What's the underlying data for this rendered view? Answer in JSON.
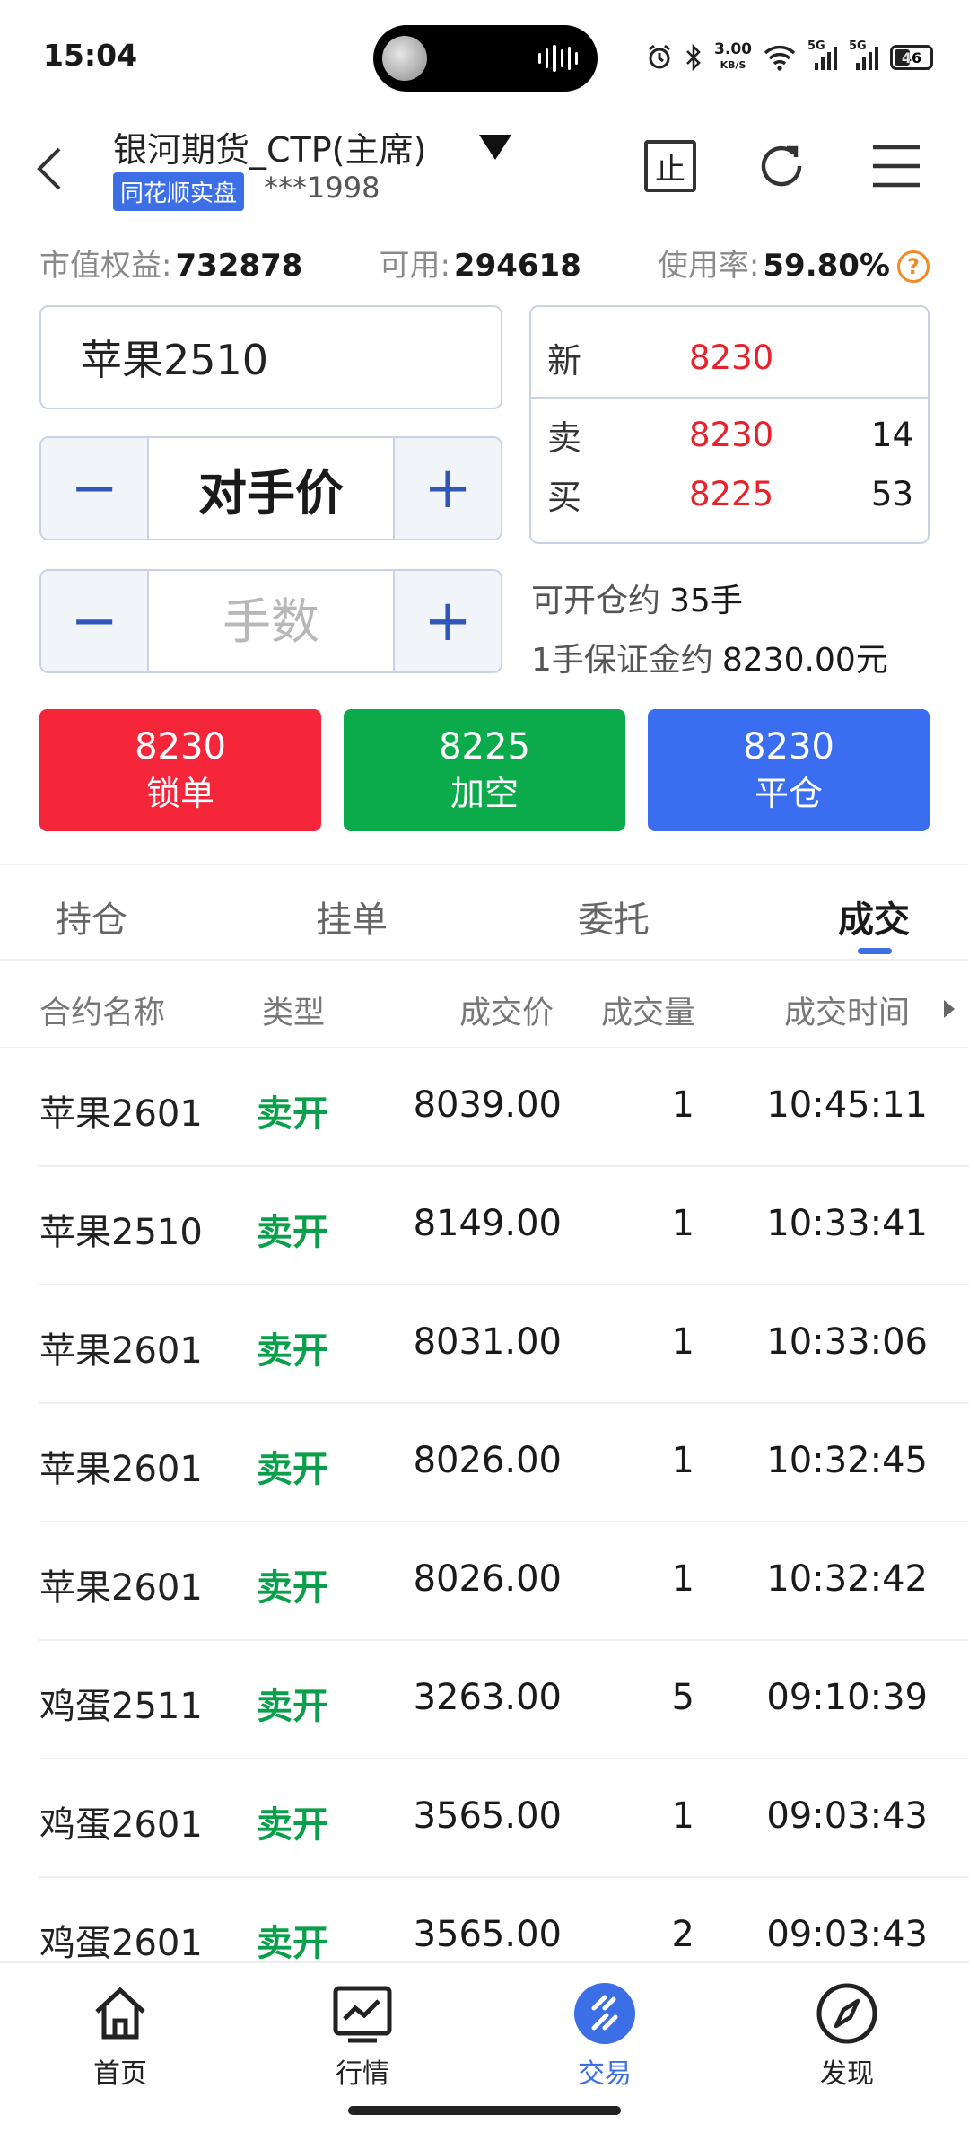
{
  "status_bar": {
    "time": "15:04",
    "net_speed_value": "3.00",
    "net_speed_unit": "KB/S",
    "signal_1": "5G",
    "signal_2": "5G",
    "battery": "46",
    "battery_level": 0.46
  },
  "header": {
    "account_name": "银河期货_CTP(主席)",
    "broker_tag": "同花顺实盘",
    "account_no": "***1998",
    "stop_label": "止"
  },
  "summary": {
    "equity_label": "市值权益:",
    "equity_value": "732878",
    "available_label": "可用:",
    "available_value": "294618",
    "usage_label": "使用率:",
    "usage_value": "59.80%",
    "help": "?"
  },
  "order": {
    "contract": "苹果2510",
    "price_type": "对手价",
    "quantity_placeholder": "手数",
    "minus": "−",
    "plus": "+"
  },
  "quote": {
    "last_label": "新",
    "last_price": "8230",
    "ask_label": "卖",
    "ask_price": "8230",
    "ask_volume": "14",
    "bid_label": "买",
    "bid_price": "8225",
    "bid_volume": "53"
  },
  "info": {
    "open_label": "可开仓约",
    "open_value": "35手",
    "margin_label": "1手保证金约",
    "margin_value": "8230.00元"
  },
  "actions": [
    {
      "price": "8230",
      "label": "锁单",
      "color": "#f5253a"
    },
    {
      "price": "8225",
      "label": "加空",
      "color": "#0bab4c"
    },
    {
      "price": "8230",
      "label": "平仓",
      "color": "#3a6df0"
    }
  ],
  "tabs": [
    {
      "label": "持仓"
    },
    {
      "label": "挂单"
    },
    {
      "label": "委托"
    },
    {
      "label": "成交"
    }
  ],
  "active_tab": "成交",
  "table": {
    "headers": [
      "合约名称",
      "类型",
      "成交价",
      "成交量",
      "成交时间"
    ],
    "rows": [
      {
        "name": "苹果2601",
        "type": "卖开",
        "price": "8039.00",
        "volume": "1",
        "time": "10:45:11"
      },
      {
        "name": "苹果2510",
        "type": "卖开",
        "price": "8149.00",
        "volume": "1",
        "time": "10:33:41"
      },
      {
        "name": "苹果2601",
        "type": "卖开",
        "price": "8031.00",
        "volume": "1",
        "time": "10:33:06"
      },
      {
        "name": "苹果2601",
        "type": "卖开",
        "price": "8026.00",
        "volume": "1",
        "time": "10:32:45"
      },
      {
        "name": "苹果2601",
        "type": "卖开",
        "price": "8026.00",
        "volume": "1",
        "time": "10:32:42"
      },
      {
        "name": "鸡蛋2511",
        "type": "卖开",
        "price": "3263.00",
        "volume": "5",
        "time": "09:10:39"
      },
      {
        "name": "鸡蛋2601",
        "type": "卖开",
        "price": "3565.00",
        "volume": "1",
        "time": "09:03:43"
      },
      {
        "name": "鸡蛋2601",
        "type": "卖开",
        "price": "3565.00",
        "volume": "2",
        "time": "09:03:43"
      }
    ]
  },
  "nav": [
    {
      "label": "首页",
      "icon": "home-icon"
    },
    {
      "label": "行情",
      "icon": "chart-icon"
    },
    {
      "label": "交易",
      "icon": "trade-icon"
    },
    {
      "label": "发现",
      "icon": "compass-icon"
    }
  ],
  "active_nav": "交易",
  "colors": {
    "accent": "#3c6fe6",
    "up_red": "#e8222b",
    "sell_green": "#0aa04b",
    "warning": "#f08a24"
  }
}
